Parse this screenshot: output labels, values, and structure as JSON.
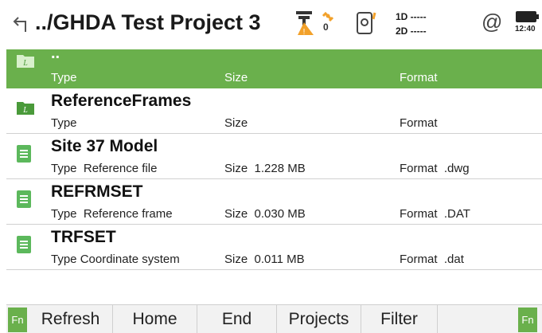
{
  "header": {
    "back_icon": "back-arrow-icon",
    "title": "../GHDA Test Project 3",
    "satellite_count": "0",
    "dop_1d": "1D -----",
    "dop_2d": "2D -----",
    "at_symbol": "@",
    "battery_time": "12:40"
  },
  "colors": {
    "accent": "#6ab04c",
    "folder": "#4a9a3a",
    "file": "#5cb85c"
  },
  "rows": [
    {
      "name": "..",
      "type_label": "Type",
      "type_value": "",
      "size_label": "Size",
      "size_value": "",
      "format_label": "Format",
      "format_value": "",
      "icon": "folder-icon",
      "selected": true
    },
    {
      "name": "ReferenceFrames",
      "type_label": "Type",
      "type_value": "",
      "size_label": "Size",
      "size_value": "",
      "format_label": "Format",
      "format_value": "",
      "icon": "folder-icon",
      "selected": false
    },
    {
      "name": "Site 37 Model",
      "type_label": "Type",
      "type_value": "Reference file",
      "size_label": "Size",
      "size_value": "1.228 MB",
      "format_label": "Format",
      "format_value": ".dwg",
      "icon": "file-icon",
      "selected": false
    },
    {
      "name": "REFRMSET",
      "type_label": "Type",
      "type_value": "Reference frame",
      "size_label": "Size",
      "size_value": "0.030 MB",
      "format_label": "Format",
      "format_value": ".DAT",
      "icon": "file-icon",
      "selected": false
    },
    {
      "name": "TRFSET",
      "type_label": "Type",
      "type_value": "Coordinate system",
      "size_label": "Size",
      "size_value": "0.011 MB",
      "format_label": "Format",
      "format_value": ".dat",
      "icon": "file-icon",
      "selected": false
    }
  ],
  "footer": {
    "fn_left": "Fn",
    "fn_right": "Fn",
    "keys": [
      "Refresh",
      "Home",
      "End",
      "Projects",
      "Filter",
      ""
    ]
  }
}
